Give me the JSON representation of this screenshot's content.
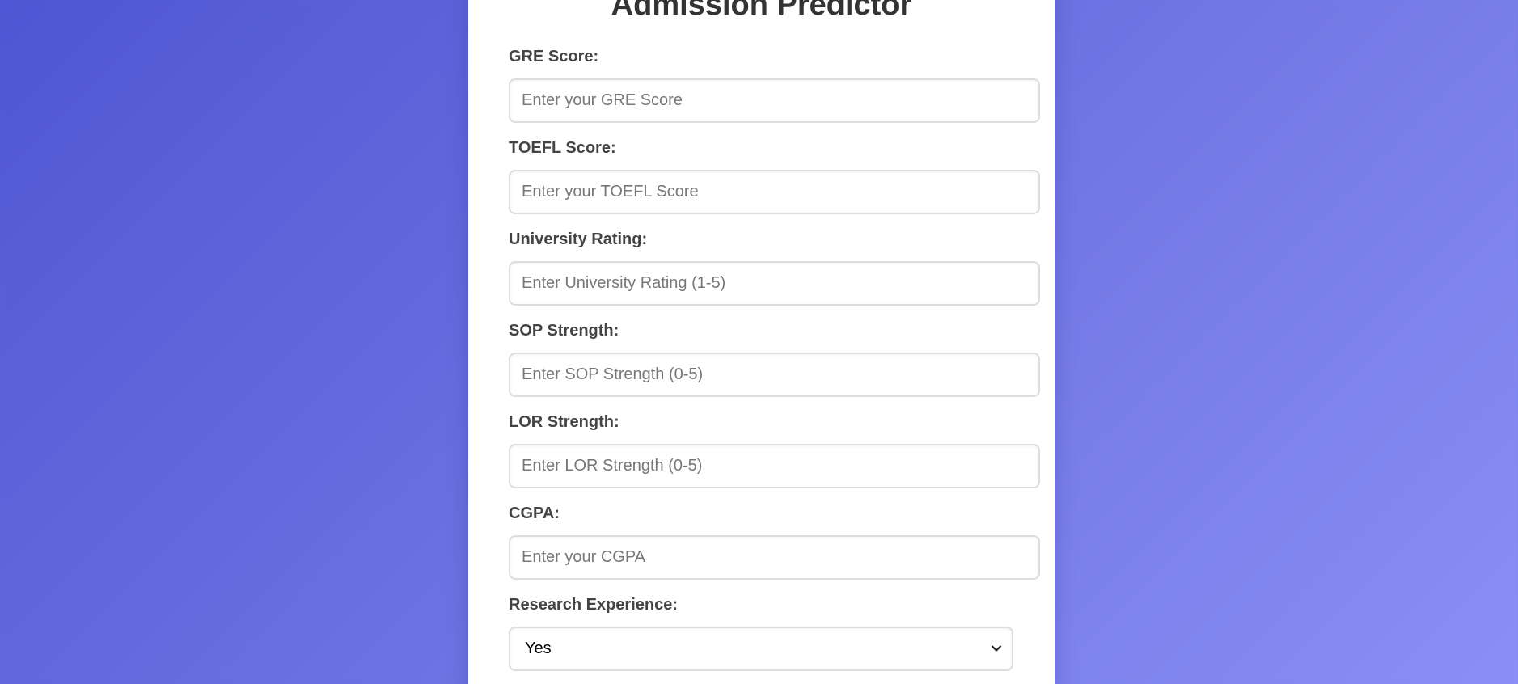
{
  "title": "Admission Predictor",
  "fields": [
    {
      "label": "GRE Score:",
      "placeholder": "Enter your GRE Score",
      "value": ""
    },
    {
      "label": "TOEFL Score:",
      "placeholder": "Enter your TOEFL Score",
      "value": ""
    },
    {
      "label": "University Rating:",
      "placeholder": "Enter University Rating (1-5)",
      "value": ""
    },
    {
      "label": "SOP Strength:",
      "placeholder": "Enter SOP Strength (0-5)",
      "value": ""
    },
    {
      "label": "LOR Strength:",
      "placeholder": "Enter LOR Strength (0-5)",
      "value": ""
    },
    {
      "label": "CGPA:",
      "placeholder": "Enter your CGPA",
      "value": ""
    }
  ],
  "research": {
    "label": "Research Experience:",
    "selected": "Yes"
  },
  "colors": {
    "background_start": "#4f56d3",
    "background_end": "#8a8ff5",
    "card": "#ffffff",
    "label_text": "#444444",
    "title_text": "#333333"
  }
}
